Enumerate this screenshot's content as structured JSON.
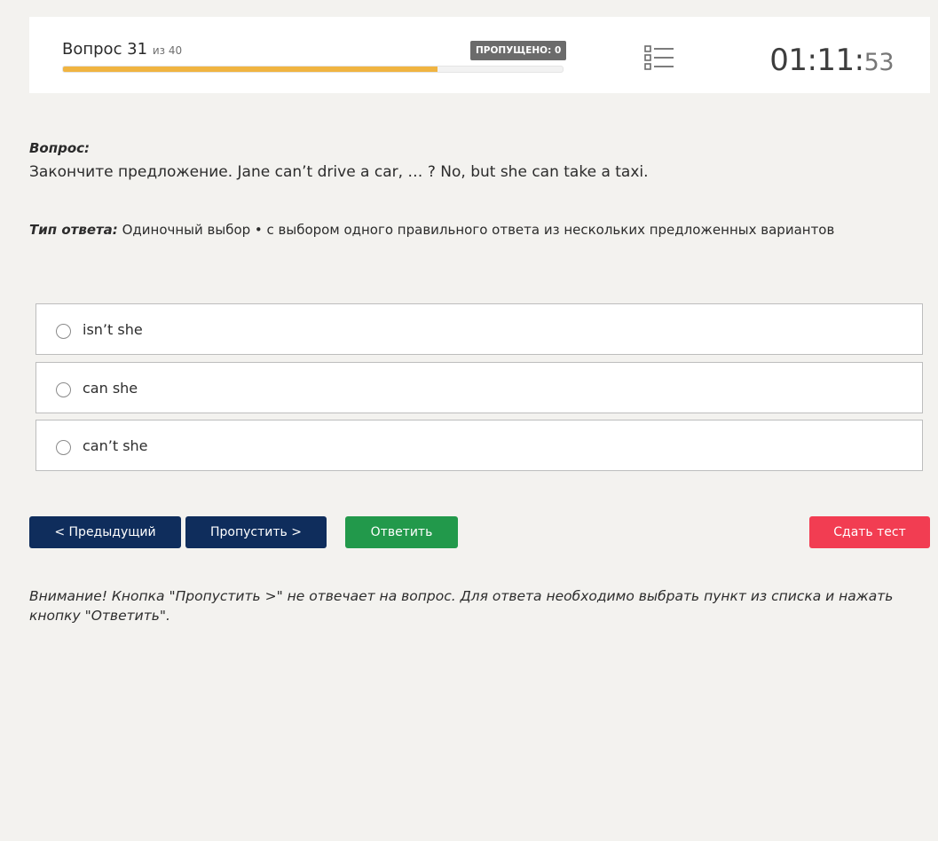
{
  "header": {
    "question_label": "Вопрос 31",
    "question_of": "из 40",
    "skipped_badge": "ПРОПУЩЕНО: 0",
    "progress_percent": 75,
    "progress_color": "#f0b441",
    "list_icon": "list-icon",
    "timer_main": "01:11:",
    "timer_seconds": "53"
  },
  "question": {
    "label": "Вопрос:",
    "text": "Закончите предложение. Jane can’t drive a car, … ? No, but she can take a taxi.",
    "answer_type_label": "Тип ответа:",
    "answer_type_value": " Одиночный выбор • с выбором одного правильного ответа из нескольких предложенных вариантов"
  },
  "options": [
    {
      "label": "isn’t she",
      "selected": false
    },
    {
      "label": "can she",
      "selected": false
    },
    {
      "label": "can’t she",
      "selected": false
    }
  ],
  "buttons": {
    "prev": "< Предыдущий",
    "skip": "Пропустить >",
    "answer": "Ответить",
    "finish": "Сдать тест"
  },
  "colors": {
    "nav_button": "#0f2d5c",
    "answer_button": "#22994b",
    "finish_button": "#f23d52",
    "background": "#f3f2ef"
  },
  "warning": "Внимание! Кнопка \"Пропустить >\" не отвечает на вопрос. Для ответа необходимо выбрать пункт из списка и нажать кнопку \"Ответить\"."
}
